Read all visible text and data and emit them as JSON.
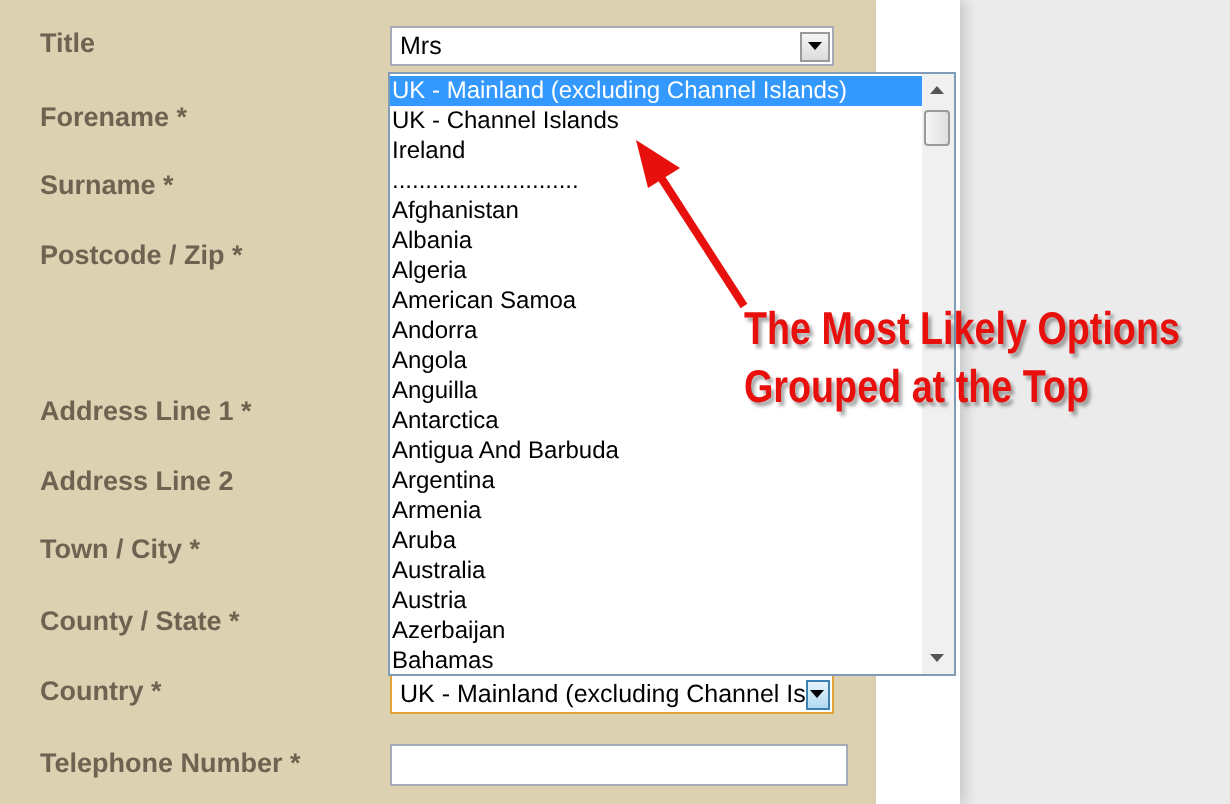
{
  "form": {
    "fields": [
      {
        "label": "Title",
        "control": {
          "kind": "select",
          "value": "Mrs",
          "focused": false
        }
      },
      {
        "label": "Forename *"
      },
      {
        "label": "Surname *"
      },
      {
        "label": "Postcode / Zip *"
      },
      {
        "label": "Address Line 1 *"
      },
      {
        "label": "Address Line 2"
      },
      {
        "label": "Town / City *"
      },
      {
        "label": "County / State *"
      },
      {
        "label": "Country *",
        "control": {
          "kind": "select",
          "value": "UK - Mainland (excluding Channel Is",
          "focused": true,
          "expanded": true,
          "options": [
            {
              "label": "UK - Mainland (excluding Channel Islands)",
              "selected": true
            },
            {
              "label": "UK - Channel Islands",
              "selected": false
            },
            {
              "label": "Ireland",
              "selected": false
            },
            {
              "label": "............................",
              "selected": false
            },
            {
              "label": "Afghanistan",
              "selected": false
            },
            {
              "label": "Albania",
              "selected": false
            },
            {
              "label": "Algeria",
              "selected": false
            },
            {
              "label": "American Samoa",
              "selected": false
            },
            {
              "label": "Andorra",
              "selected": false
            },
            {
              "label": "Angola",
              "selected": false
            },
            {
              "label": "Anguilla",
              "selected": false
            },
            {
              "label": "Antarctica",
              "selected": false
            },
            {
              "label": "Antigua And Barbuda",
              "selected": false
            },
            {
              "label": "Argentina",
              "selected": false
            },
            {
              "label": "Armenia",
              "selected": false
            },
            {
              "label": "Aruba",
              "selected": false
            },
            {
              "label": "Australia",
              "selected": false
            },
            {
              "label": "Austria",
              "selected": false
            },
            {
              "label": "Azerbaijan",
              "selected": false
            },
            {
              "label": "Bahamas",
              "selected": false
            }
          ]
        }
      },
      {
        "label": "Telephone Number *",
        "control": {
          "kind": "text",
          "focused": false
        }
      }
    ]
  },
  "annotation": {
    "lines": [
      "The Most Likely Options",
      "Grouped at the Top"
    ]
  }
}
